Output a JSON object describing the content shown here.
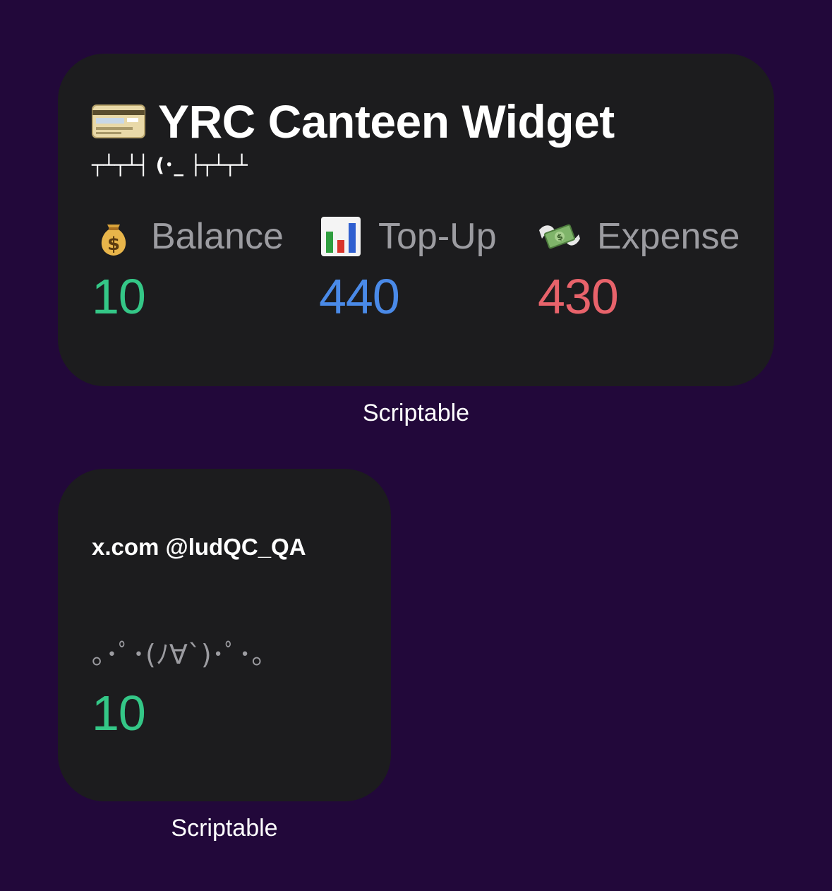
{
  "background_color": "#22083a",
  "widgets": [
    {
      "size": "medium",
      "title_icon": "credit-card-icon",
      "title": "YRC Canteen Widget",
      "kaomoji": "┬┴┬┴┤ (･_ ├┬┴┬┴",
      "stats": [
        {
          "icon": "money-bag-icon",
          "label": "Balance",
          "value": "10",
          "color": "#34c787"
        },
        {
          "icon": "bar-chart-icon",
          "label": "Top-Up",
          "value": "440",
          "color": "#4a8ae8"
        },
        {
          "icon": "money-with-wings-icon",
          "label": "Expense",
          "value": "430",
          "color": "#e8636b"
        }
      ],
      "caption": "Scriptable"
    },
    {
      "size": "small",
      "handle": "x.com @ludQC_QA",
      "kaomoji": "｡･ﾟ･(ﾉ∀`)･ﾟ･｡",
      "value": "10",
      "value_color": "#34c787",
      "caption": "Scriptable"
    }
  ]
}
